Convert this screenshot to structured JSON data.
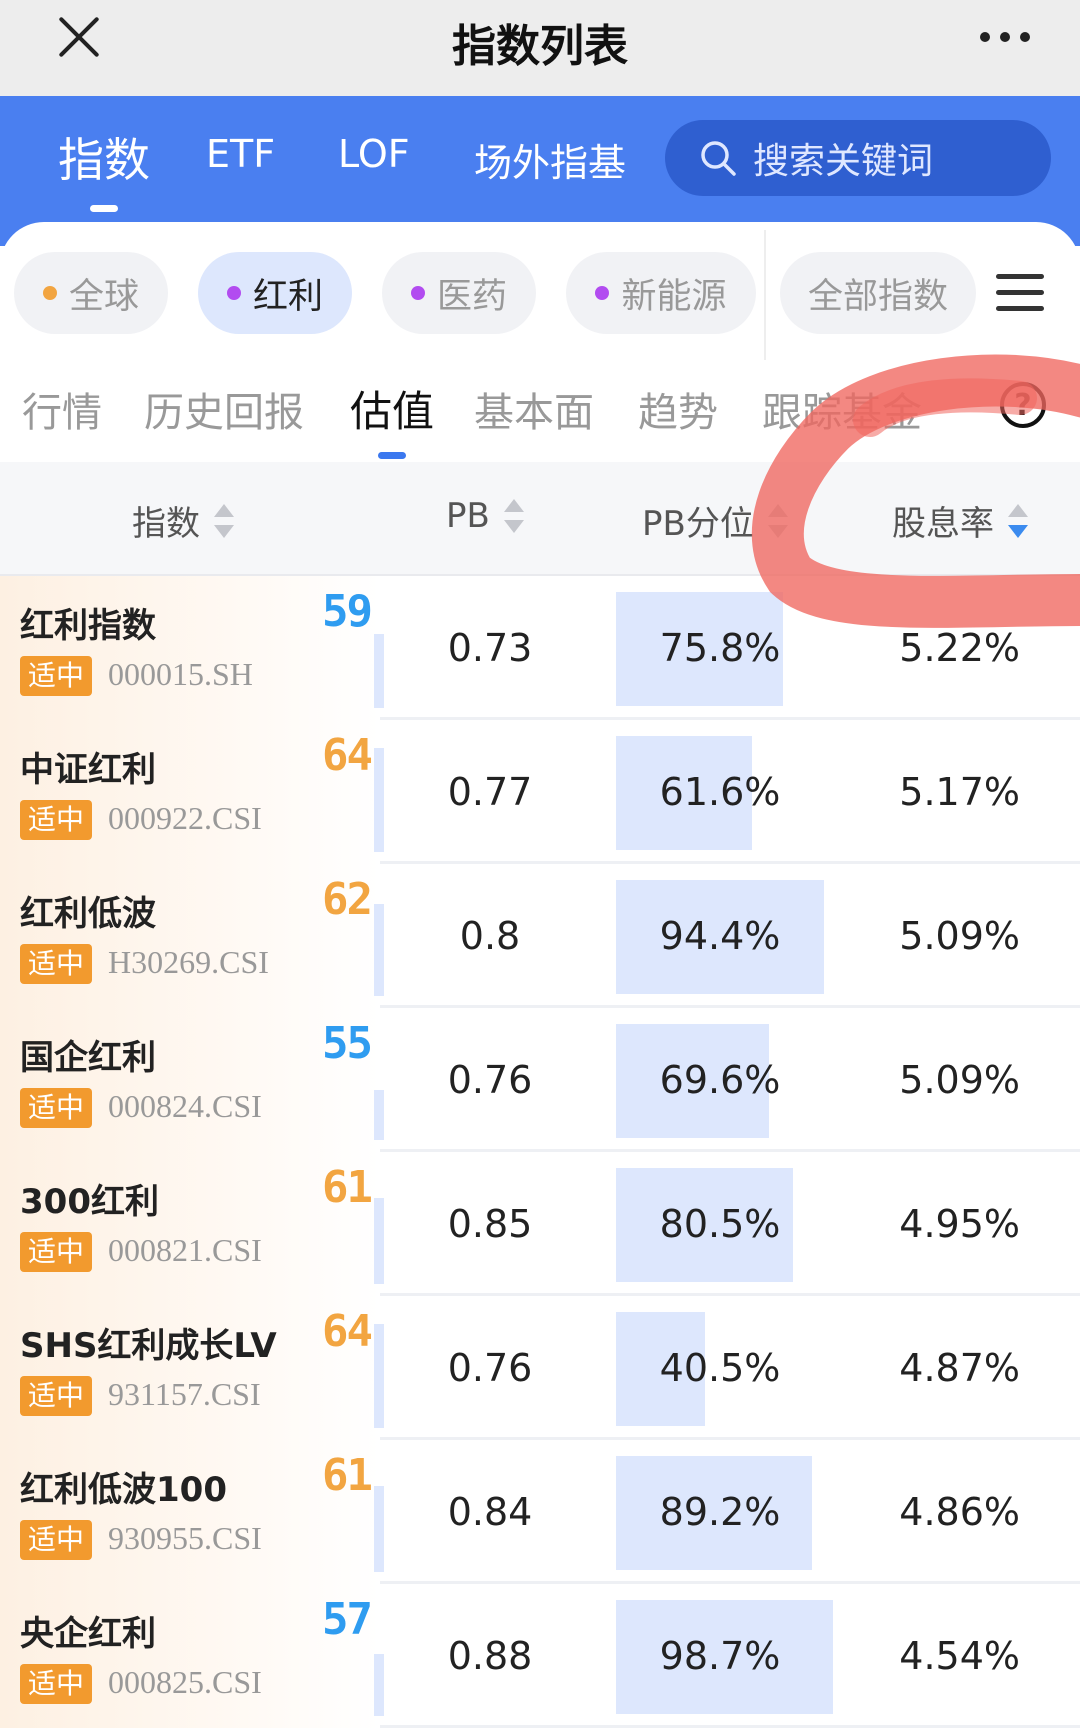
{
  "titlebar": {
    "title": "指数列表"
  },
  "tabs": [
    {
      "label": "指数",
      "active": true
    },
    {
      "label": "ETF",
      "active": false
    },
    {
      "label": "LOF",
      "active": false
    },
    {
      "label": "场外指基",
      "active": false
    }
  ],
  "search": {
    "placeholder": "搜索关键词"
  },
  "chips": [
    {
      "label": "全球",
      "dot_color": "#f2a541",
      "active": false
    },
    {
      "label": "红利",
      "dot_color": "#b24cf0",
      "active": true
    },
    {
      "label": "医药",
      "dot_color": "#b24cf0",
      "active": false
    },
    {
      "label": "新能源",
      "dot_color": "#b24cf0",
      "active": false
    },
    {
      "label": "全部指数",
      "active": false
    }
  ],
  "subtabs": [
    {
      "label": "行情",
      "active": false
    },
    {
      "label": "历史回报",
      "active": false
    },
    {
      "label": "估值",
      "active": true
    },
    {
      "label": "基本面",
      "active": false
    },
    {
      "label": "趋势",
      "active": false
    },
    {
      "label": "跟踪基金",
      "active": false
    }
  ],
  "table": {
    "headers": {
      "index": "指数",
      "pb": "PB",
      "pb_pct": "PB分位",
      "yield": "股息率"
    },
    "sort": {
      "column": "股息率",
      "direction": "desc"
    },
    "rows": [
      {
        "name": "红利指数",
        "badge": "适中",
        "code": "000015.SH",
        "score": "59",
        "score_color": "#2f9cf0",
        "pb": "0.73",
        "pb_pct": "75.8%",
        "pb_pct_value": 75.8,
        "yield": "5.22%"
      },
      {
        "name": "中证红利",
        "badge": "适中",
        "code": "000922.CSI",
        "score": "64",
        "score_color": "#f2a541",
        "pb": "0.77",
        "pb_pct": "61.6%",
        "pb_pct_value": 61.6,
        "yield": "5.17%"
      },
      {
        "name": "红利低波",
        "badge": "适中",
        "code": "H30269.CSI",
        "score": "62",
        "score_color": "#f2a541",
        "pb": "0.8",
        "pb_pct": "94.4%",
        "pb_pct_value": 94.4,
        "yield": "5.09%"
      },
      {
        "name": "国企红利",
        "badge": "适中",
        "code": "000824.CSI",
        "score": "55",
        "score_color": "#2f9cf0",
        "pb": "0.76",
        "pb_pct": "69.6%",
        "pb_pct_value": 69.6,
        "yield": "5.09%"
      },
      {
        "name": "300红利",
        "badge": "适中",
        "code": "000821.CSI",
        "score": "61",
        "score_color": "#f2a541",
        "pb": "0.85",
        "pb_pct": "80.5%",
        "pb_pct_value": 80.5,
        "yield": "4.95%"
      },
      {
        "name": "SHS红利成长LV",
        "badge": "适中",
        "code": "931157.CSI",
        "score": "64",
        "score_color": "#f2a541",
        "pb": "0.76",
        "pb_pct": "40.5%",
        "pb_pct_value": 40.5,
        "yield": "4.87%"
      },
      {
        "name": "红利低波100",
        "badge": "适中",
        "code": "930955.CSI",
        "score": "61",
        "score_color": "#f2a541",
        "pb": "0.84",
        "pb_pct": "89.2%",
        "pb_pct_value": 89.2,
        "yield": "4.86%"
      },
      {
        "name": "央企红利",
        "badge": "适中",
        "code": "000825.CSI",
        "score": "57",
        "score_color": "#2f9cf0",
        "pb": "0.88",
        "pb_pct": "98.7%",
        "pb_pct_value": 98.7,
        "yield": "4.54%"
      }
    ]
  },
  "colors": {
    "accent": "#4a7ff0",
    "badge": "#f29a2e",
    "bar": "#dde7fd",
    "annotation": "#f0665f"
  }
}
